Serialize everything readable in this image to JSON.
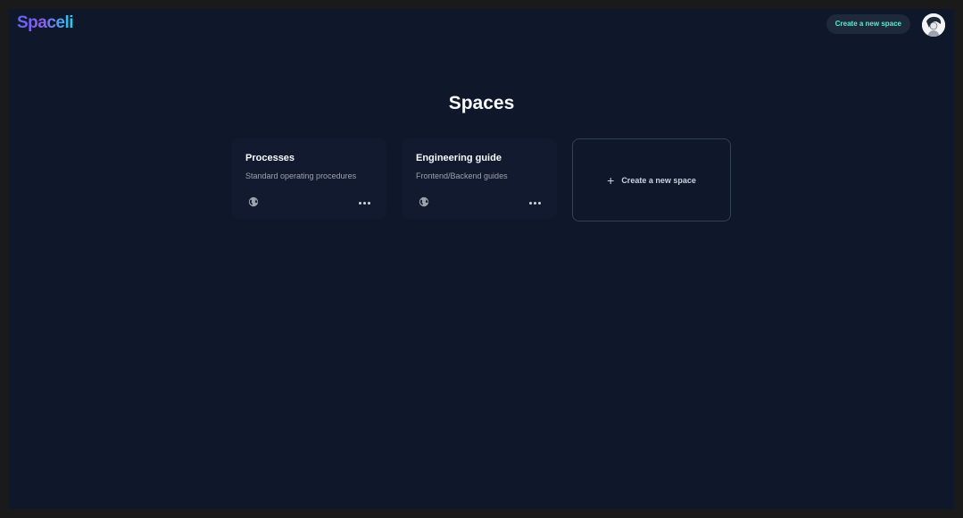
{
  "app": {
    "logo_text": "Spaceli",
    "create_space_button_label": "Create a new space"
  },
  "page": {
    "title": "Spaces"
  },
  "spaces": [
    {
      "name": "Processes",
      "description": "Standard operating procedures",
      "visibility_icon": "globe-icon",
      "menu_icon": "more-horizontal-icon"
    },
    {
      "name": "Engineering guide",
      "description": "Frontend/Backend guides",
      "visibility_icon": "globe-icon",
      "menu_icon": "more-horizontal-icon"
    }
  ],
  "new_space_card": {
    "icon": "plus-icon",
    "label": "Create a new space"
  },
  "colors": {
    "background": "#0f172a",
    "card_background": "#111a2e",
    "accent_teal": "#5eead4",
    "logo_gradient_start": "#6366f1",
    "logo_gradient_end": "#22d3ee"
  }
}
